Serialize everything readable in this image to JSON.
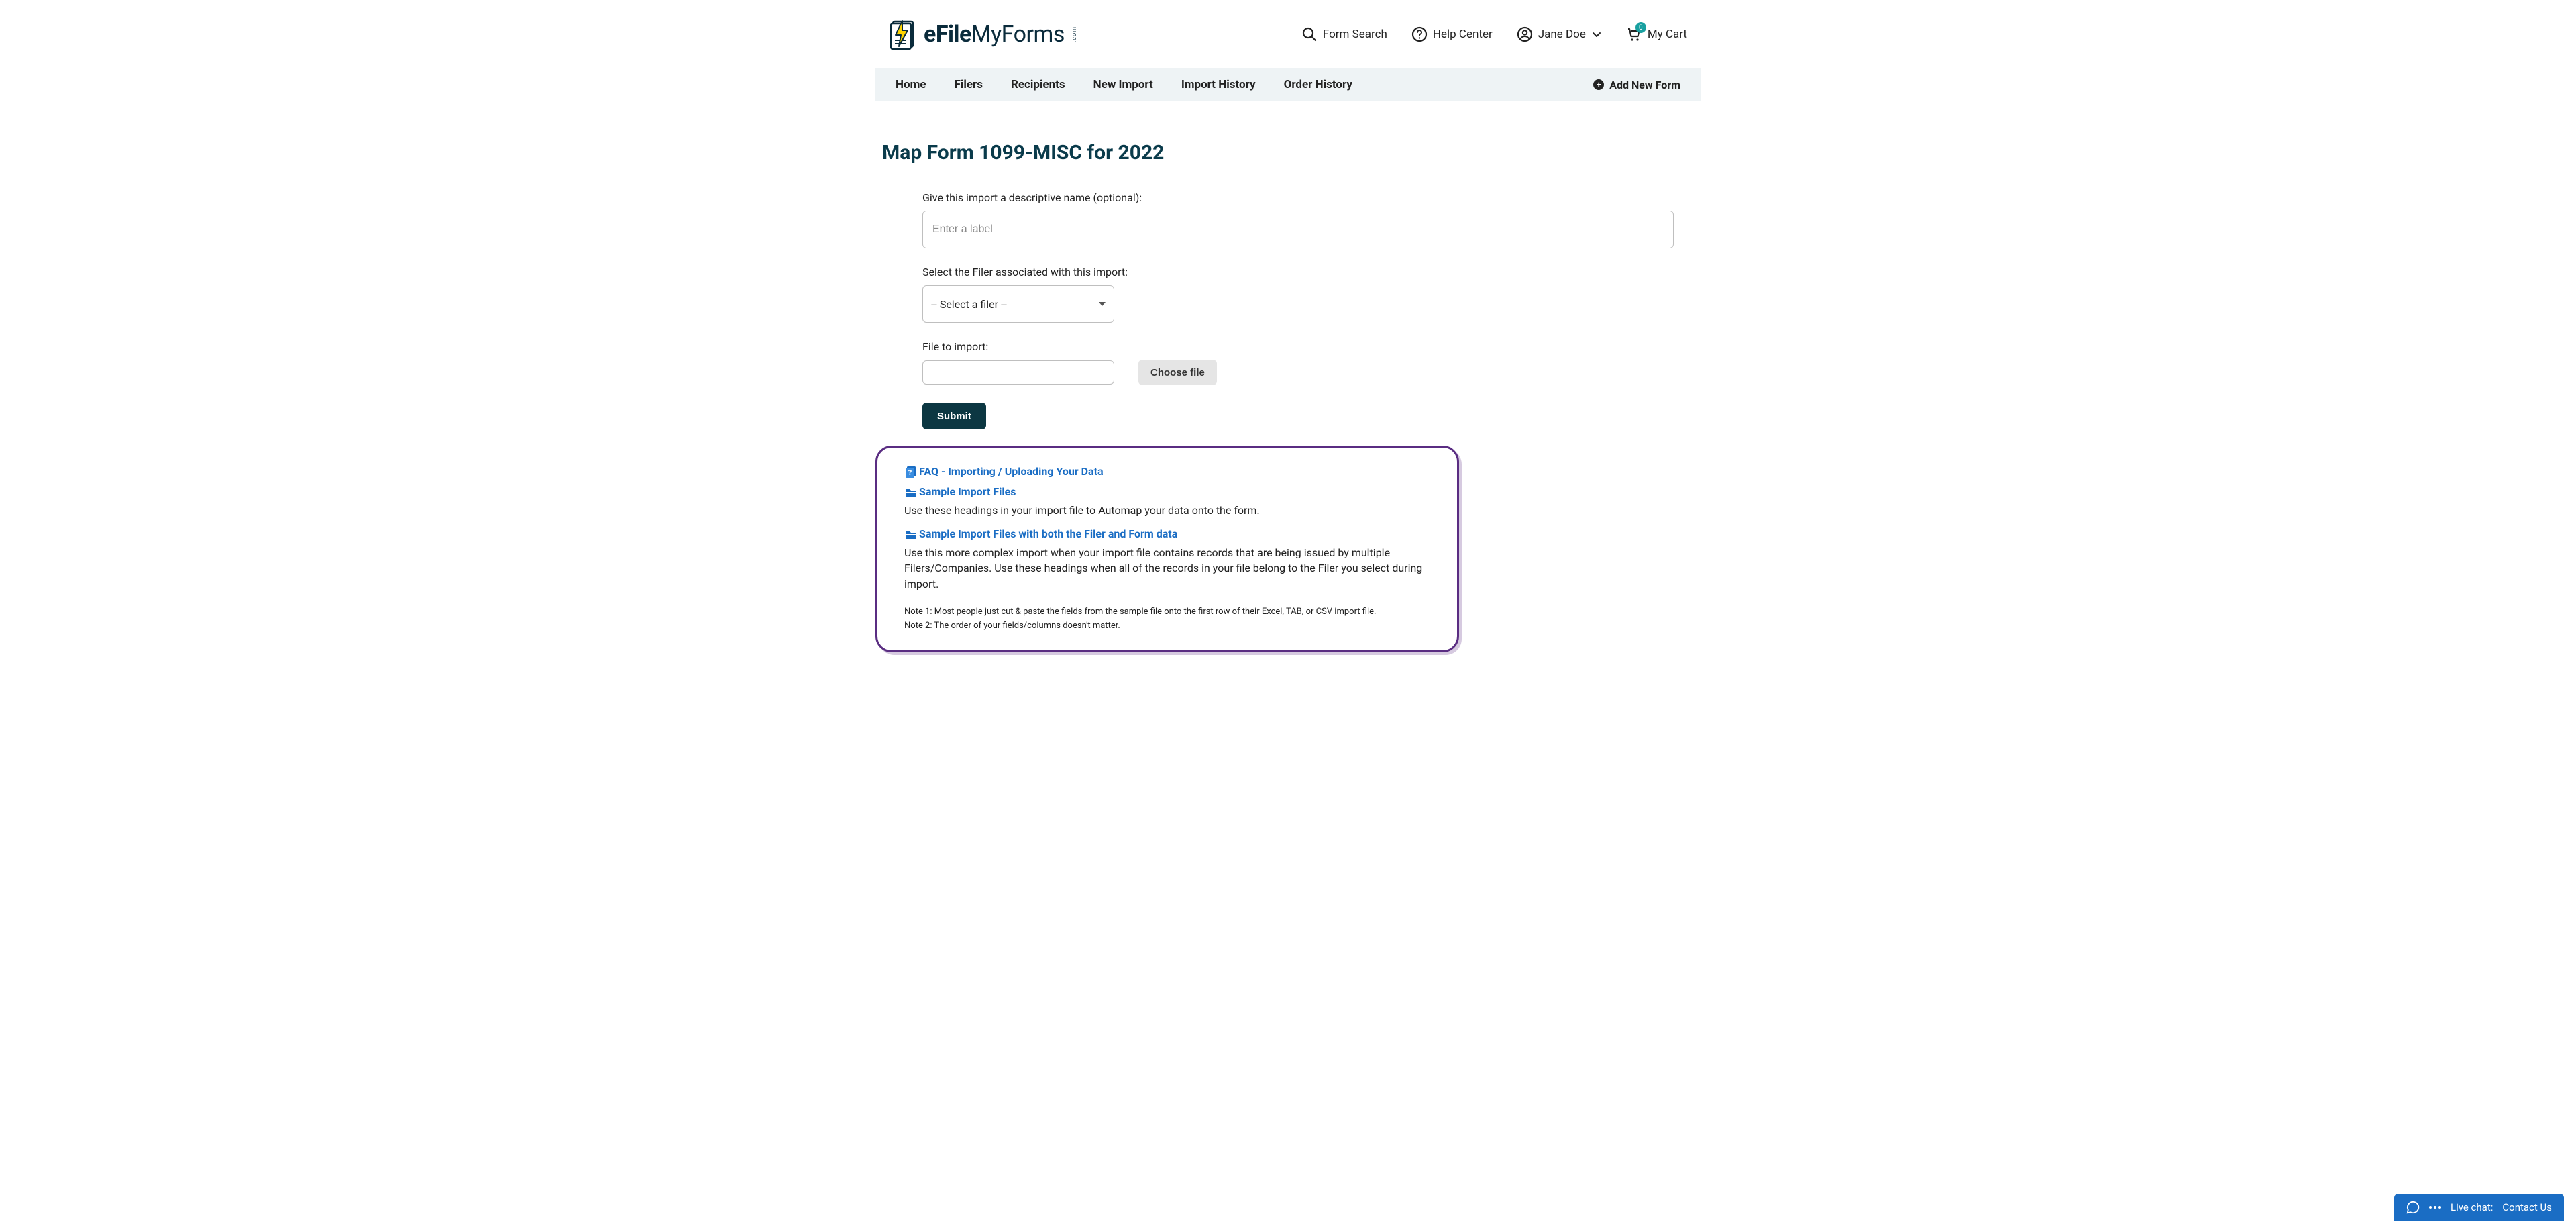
{
  "header": {
    "logo_bold": "eFile",
    "logo_light": "MyForms",
    "logo_suffix": ".com",
    "form_search": "Form Search",
    "help_center": "Help Center",
    "user_name": "Jane Doe",
    "cart_label": "My Cart",
    "cart_count": "0"
  },
  "nav": {
    "items": [
      "Home",
      "Filers",
      "Recipients",
      "New Import",
      "Import History",
      "Order History"
    ],
    "add_new_form": "Add New Form"
  },
  "page": {
    "title": "Map Form 1099-MISC for 2022",
    "label_name": "Give this import a descriptive name (optional):",
    "placeholder_name": "Enter a label",
    "label_filer": "Select the Filer associated with this import:",
    "filer_selected": "-- Select a filer --",
    "label_file": "File to import:",
    "choose_file": "Choose file",
    "submit": "Submit"
  },
  "help": {
    "faq_link": "FAQ - Importing / Uploading Your Data",
    "sample1_link": "Sample Import Files",
    "sample1_text": "Use these headings in your import file to Automap your data onto the form.",
    "sample2_link": "Sample Import Files with both the Filer and Form data",
    "sample2_text": "Use this more complex import when your import file contains records that are being issued by multiple Filers/Companies. Use these headings when all of the records in your file belong to the Filer you select during import.",
    "note1": "Note 1: Most people just cut & paste the fields from the sample file onto the first row of their Excel, TAB, or CSV import file.",
    "note2": "Note 2: The order of your fields/columns doesn't matter."
  },
  "chat": {
    "prefix": "Live chat:",
    "label": "Contact Us"
  }
}
